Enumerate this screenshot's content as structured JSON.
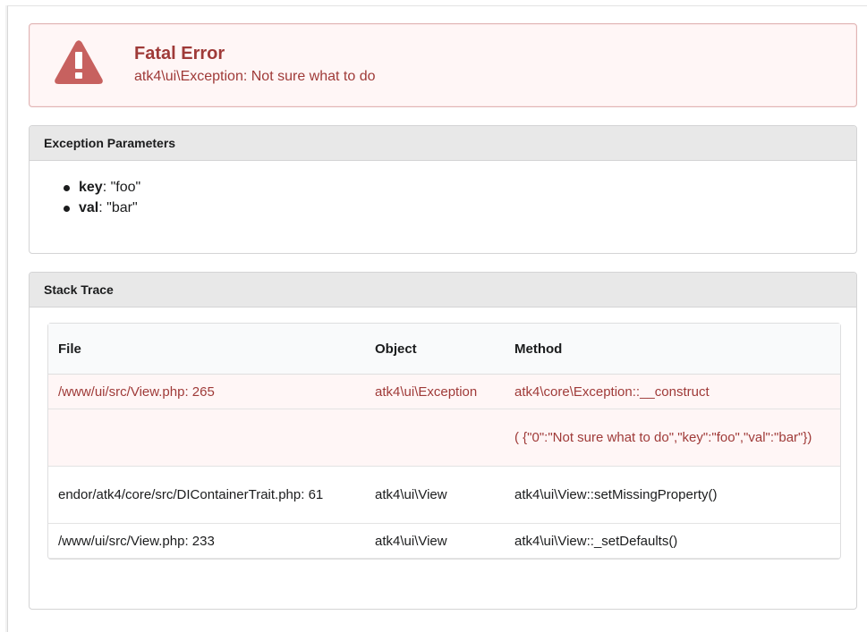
{
  "error": {
    "title": "Fatal Error",
    "message": "atk4\\ui\\Exception: Not sure what to do",
    "icon": "warning-triangle-icon",
    "accent_color": "#9f3a38"
  },
  "params": {
    "header": "Exception Parameters",
    "items": [
      {
        "key": "key",
        "value": ": \"foo\""
      },
      {
        "key": "val",
        "value": ": \"bar\""
      }
    ]
  },
  "trace": {
    "header": "Stack Trace",
    "columns": [
      "File",
      "Object",
      "Method"
    ],
    "rows": [
      {
        "file": "/www/ui/src/View.php: 265",
        "object": "atk4\\ui\\Exception",
        "method": "atk4\\core\\Exception::__construct",
        "highlight": true
      },
      {
        "file": "",
        "object": "",
        "method": "( {\"0\":\"Not sure what to do\",\"key\":\"foo\",\"val\":\"bar\"})",
        "highlight": true
      },
      {
        "file": "endor/atk4/core/src/DIContainerTrait.php: 61",
        "object": "atk4\\ui\\View",
        "method": "atk4\\ui\\View::setMissingProperty()",
        "highlight": false
      },
      {
        "file": "/www/ui/src/View.php: 233",
        "object": "atk4\\ui\\View",
        "method": "atk4\\ui\\View::_setDefaults()",
        "highlight": false
      }
    ]
  }
}
